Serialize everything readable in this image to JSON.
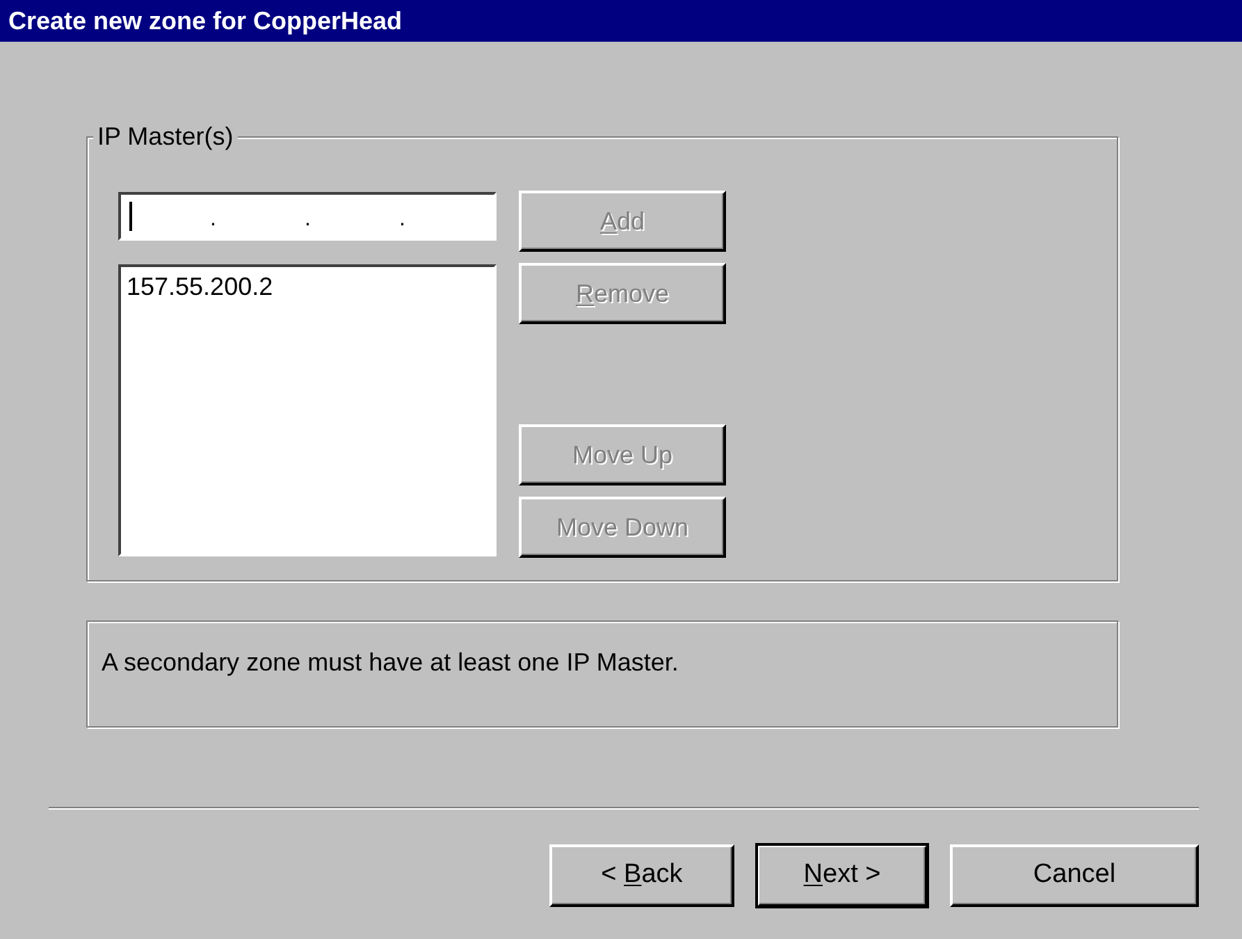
{
  "window": {
    "title": "Create new zone for CopperHead"
  },
  "ip_masters": {
    "label": "IP Master(s)",
    "address_field": {
      "separators": [
        ".",
        ".",
        "."
      ],
      "focused": true
    },
    "list_items": [
      {
        "text": "157.55.200.2",
        "selected": false
      }
    ],
    "buttons": [
      {
        "label": "Add",
        "mnemonic": true,
        "disabled": true
      },
      {
        "label": "Remove",
        "mnemonic": true,
        "disabled": true
      },
      {
        "label": "Move Up",
        "disabled": true
      },
      {
        "label": "Move Down",
        "disabled": true
      }
    ]
  },
  "message": "A secondary zone must have at least one IP Master.",
  "footer_buttons": [
    {
      "label": "< Back",
      "mnemonic": true,
      "default": false
    },
    {
      "label": "Next >",
      "mnemonic": true,
      "default": true
    },
    {
      "label": "Cancel",
      "default": false
    }
  ]
}
